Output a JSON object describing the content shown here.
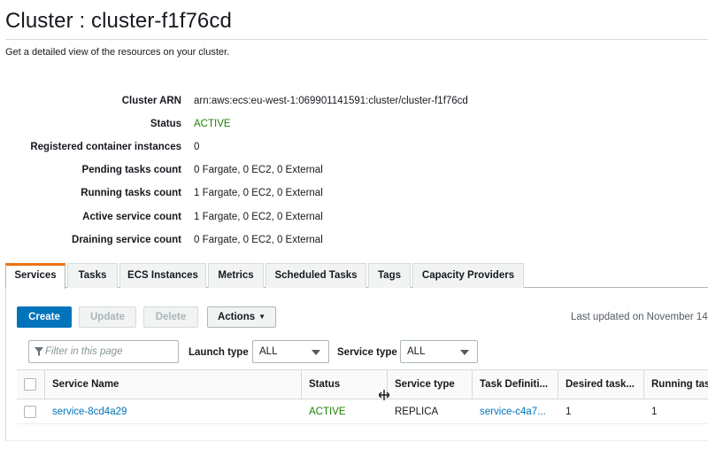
{
  "page": {
    "title": "Cluster : cluster-f1f76cd",
    "subtitle": "Get a detailed view of the resources on your cluster."
  },
  "details": [
    {
      "label": "Cluster ARN",
      "value": "arn:aws:ecs:eu-west-1:069901141591:cluster/cluster-f1f76cd"
    },
    {
      "label": "Status",
      "value": "ACTIVE"
    },
    {
      "label": "Registered container instances",
      "value": "0"
    },
    {
      "label": "Pending tasks count",
      "value": "0 Fargate, 0 EC2, 0 External"
    },
    {
      "label": "Running tasks count",
      "value": "1 Fargate, 0 EC2, 0 External"
    },
    {
      "label": "Active service count",
      "value": "1 Fargate, 0 EC2, 0 External"
    },
    {
      "label": "Draining service count",
      "value": "0 Fargate, 0 EC2, 0 External"
    }
  ],
  "tabs": [
    {
      "label": "Services",
      "active": true
    },
    {
      "label": "Tasks"
    },
    {
      "label": "ECS Instances"
    },
    {
      "label": "Metrics"
    },
    {
      "label": "Scheduled Tasks"
    },
    {
      "label": "Tags"
    },
    {
      "label": "Capacity Providers"
    }
  ],
  "toolbar": {
    "create_label": "Create",
    "update_label": "Update",
    "delete_label": "Delete",
    "actions_label": "Actions",
    "last_updated": "Last updated on November 14"
  },
  "filters": {
    "search_placeholder": "Filter in this page",
    "launch_type_label": "Launch type",
    "launch_type_value": "ALL",
    "service_type_label": "Service type",
    "service_type_value": "ALL"
  },
  "table": {
    "columns": [
      "Service Name",
      "Status",
      "Service type",
      "Task Definiti...",
      "Desired task...",
      "Running tas"
    ],
    "rows": [
      {
        "service_name": "service-8cd4a29",
        "status": "ACTIVE",
        "service_type": "REPLICA",
        "task_definition": "service-c4a7...",
        "desired": "1",
        "running": "1"
      }
    ]
  },
  "colors": {
    "primary": "#0073bb",
    "active_status": "#1d8102",
    "tab_accent": "#ec7211"
  }
}
